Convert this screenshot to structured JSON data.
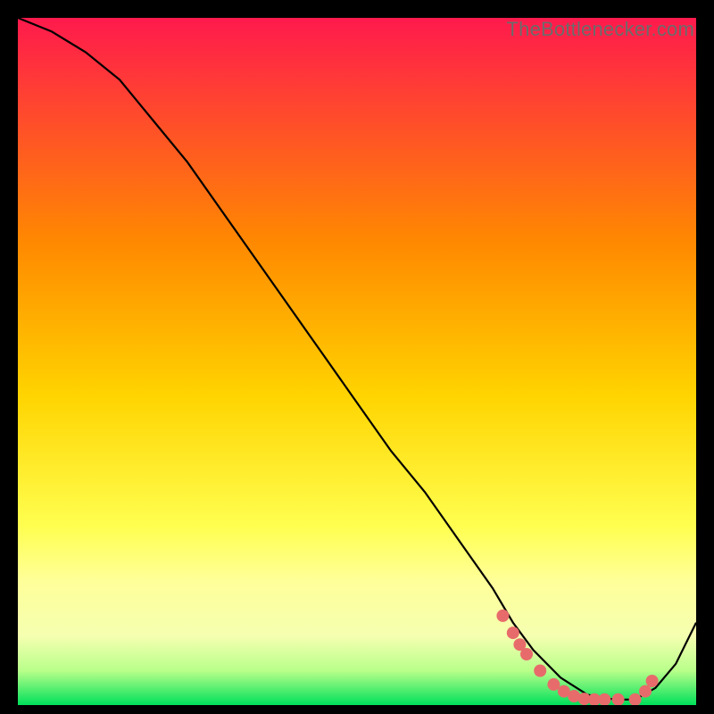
{
  "watermark": "TheBottlenecker.com",
  "chart_data": {
    "type": "line",
    "title": "",
    "xlabel": "",
    "ylabel": "",
    "xlim": [
      0,
      100
    ],
    "ylim": [
      0,
      100
    ],
    "background_gradient": {
      "top": "#ff1a4d",
      "mid": "#ffd400",
      "low": "#ffff8a",
      "bottom": "#00e05a"
    },
    "series": [
      {
        "name": "curve",
        "x": [
          0,
          5,
          10,
          15,
          20,
          25,
          30,
          35,
          40,
          45,
          50,
          55,
          60,
          65,
          70,
          73,
          76,
          80,
          84,
          88,
          91,
          94,
          97,
          100
        ],
        "y": [
          100,
          98,
          95,
          91,
          85,
          79,
          72,
          65,
          58,
          51,
          44,
          37,
          31,
          24,
          17,
          12,
          8,
          4,
          1.5,
          0.8,
          0.8,
          2.5,
          6,
          12
        ]
      }
    ],
    "markers": {
      "name": "dots",
      "x": [
        71.5,
        73.0,
        74.0,
        75.0,
        77.0,
        79.0,
        80.5,
        82.0,
        83.5,
        85.0,
        86.5,
        88.5,
        91.0,
        92.5,
        93.5
      ],
      "y": [
        13.0,
        10.5,
        8.8,
        7.4,
        5.0,
        3.0,
        2.0,
        1.3,
        0.9,
        0.8,
        0.8,
        0.8,
        0.8,
        2.0,
        3.5
      ],
      "color": "#e86b6b",
      "radius": 7
    }
  }
}
